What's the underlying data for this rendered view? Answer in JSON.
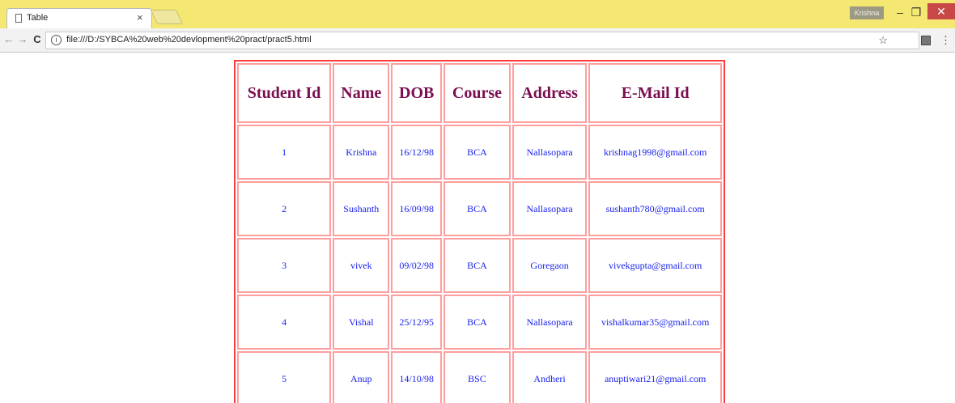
{
  "browser": {
    "tab_title": "Table",
    "tab_close": "×",
    "profile": "Krishna",
    "url": "file:///D:/SYBCA%20web%20devlopment%20pract/pract5.html",
    "colors": {
      "tabstrip": "#f4e772",
      "close": "#c84747"
    }
  },
  "table": {
    "headers": [
      "Student Id",
      "Name",
      "DOB",
      "Course",
      "Address",
      "E-Mail Id"
    ],
    "rows": [
      [
        "1",
        "Krishna",
        "16/12/98",
        "BCA",
        "Nallasopara",
        "krishnag1998@gmail.com"
      ],
      [
        "2",
        "Sushanth",
        "16/09/98",
        "BCA",
        "Nallasopara",
        "sushanth780@gmail.com"
      ],
      [
        "3",
        "vivek",
        "09/02/98",
        "BCA",
        "Goregaon",
        "vivekgupta@gmail.com"
      ],
      [
        "4",
        "Vishal",
        "25/12/95",
        "BCA",
        "Nallasopara",
        "vishalkumar35@gmail.com"
      ],
      [
        "5",
        "Anup",
        "14/10/98",
        "BSC",
        "Andheri",
        "anuptiwari21@gmail.com"
      ]
    ],
    "colors": {
      "outer_border": "#ff3b3b",
      "cell_border": "#ff9e9e",
      "header_text": "#7a0f4f",
      "cell_text": "#1a22ee"
    }
  }
}
